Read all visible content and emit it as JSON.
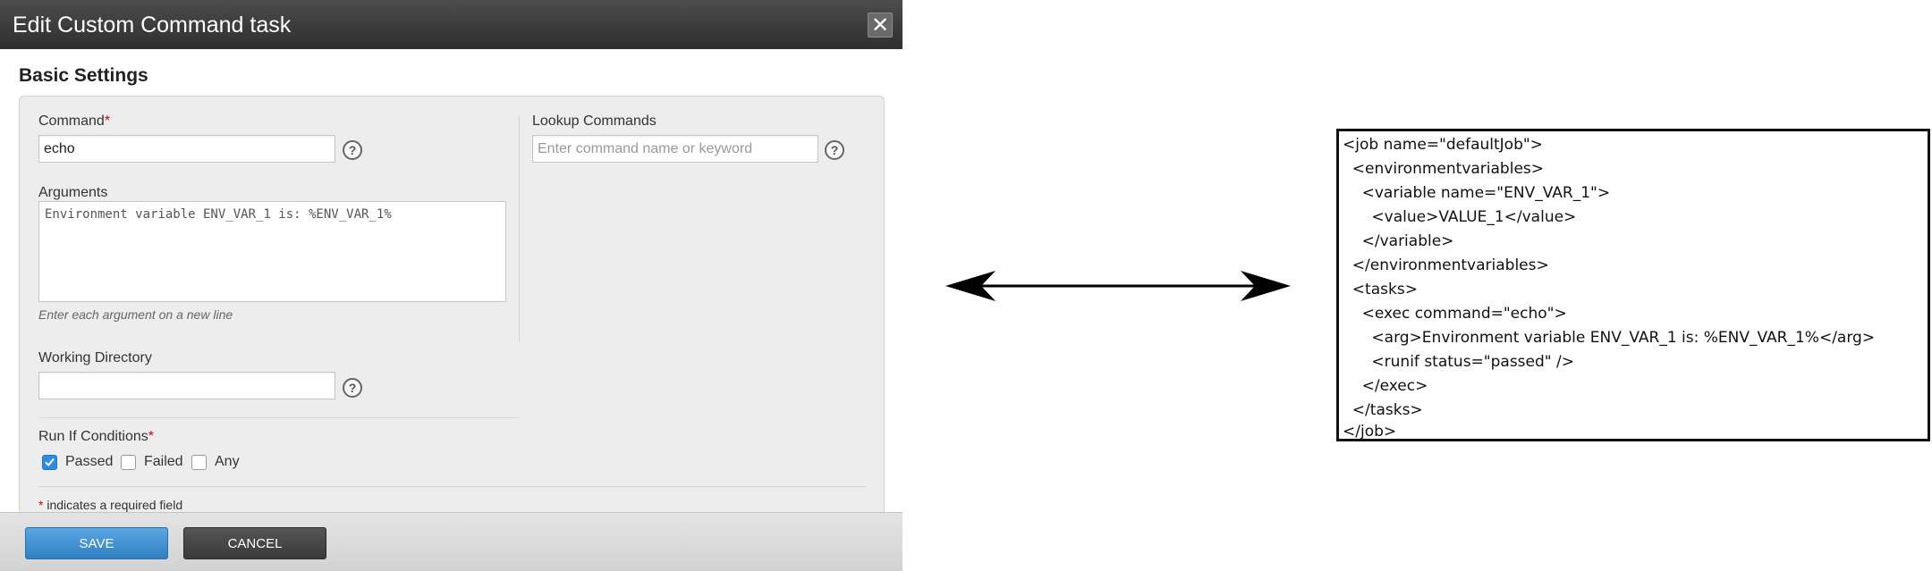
{
  "dialog": {
    "title": "Edit Custom Command task",
    "close_glyph": "✕",
    "section_title": "Basic Settings"
  },
  "command": {
    "label": "Command",
    "required_mark": "*",
    "value": "echo"
  },
  "lookup": {
    "label": "Lookup Commands",
    "placeholder": "Enter command name or keyword"
  },
  "arguments": {
    "label": "Arguments",
    "value": "Environment variable ENV_VAR_1 is: %ENV_VAR_1%",
    "hint": "Enter each argument on a new line"
  },
  "working_directory": {
    "label": "Working Directory",
    "value": ""
  },
  "help_glyph": "?",
  "run_if": {
    "label": "Run If Conditions",
    "required_mark": "*",
    "options": [
      {
        "label": "Passed",
        "checked": true
      },
      {
        "label": "Failed",
        "checked": false
      },
      {
        "label": "Any",
        "checked": false
      }
    ]
  },
  "required_note": {
    "mark": "*",
    "text": " indicates a required field"
  },
  "footer": {
    "save_label": "SAVE",
    "cancel_label": "CANCEL"
  },
  "colors": {
    "accent": "#2d8ce3",
    "required": "#d0021b",
    "titlebar": "#3a3a3a"
  },
  "arrow": {
    "icon": "double-headed-arrow-icon"
  },
  "xml_lines": [
    "<job name=\"defaultJob\">",
    "  <environmentvariables>",
    "    <variable name=\"ENV_VAR_1\">",
    "      <value>VALUE_1</value>",
    "    </variable>",
    "  </environmentvariables>",
    "  <tasks>",
    "    <exec command=\"echo\">",
    "      <arg>Environment variable ENV_VAR_1 is: %ENV_VAR_1%</arg>",
    "      <runif status=\"passed\" />",
    "    </exec>",
    "  </tasks>",
    "</job>"
  ]
}
